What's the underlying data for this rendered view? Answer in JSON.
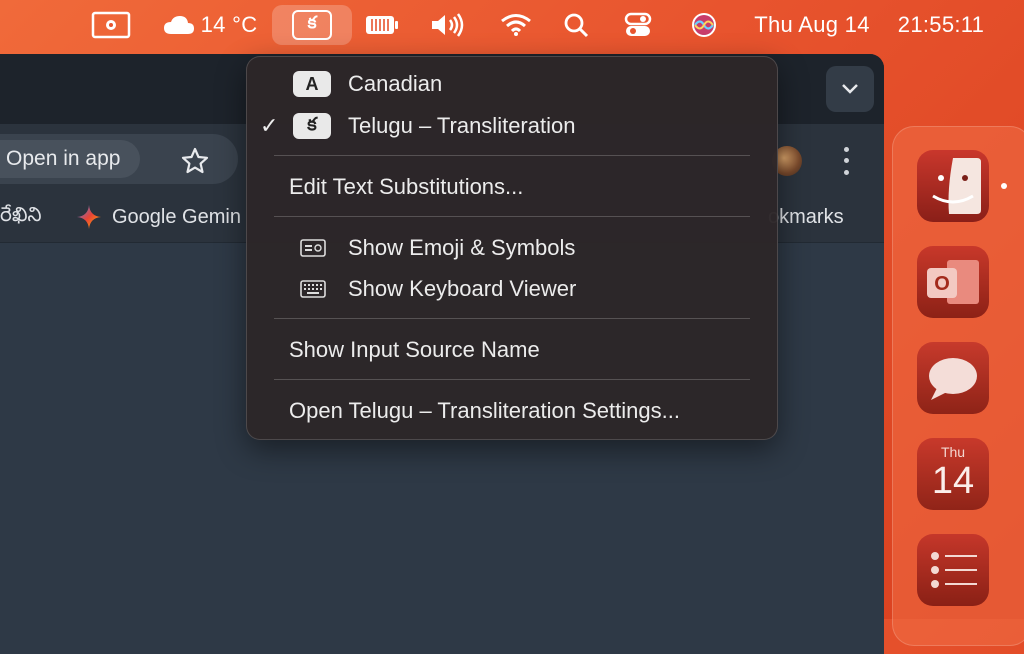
{
  "menubar": {
    "weather_temp": "14 °C",
    "input_source_glyph": "క",
    "date": "Thu Aug 14",
    "time": "21:55:11",
    "icons": [
      "screen-record-icon",
      "cloud-icon",
      "input-source-icon",
      "battery-icon",
      "volume-icon",
      "wifi-icon",
      "search-icon",
      "control-center-icon",
      "siri-icon"
    ]
  },
  "browser": {
    "open_in_app": "Open in app",
    "bookmarks": [
      "రేఖిని",
      "Google Gemin",
      "okmarks"
    ]
  },
  "menu": {
    "input_sources": [
      {
        "badge": "A",
        "label": "Canadian",
        "checked": false
      },
      {
        "badge": "క",
        "label": "Telugu – Transliteration",
        "checked": true
      }
    ],
    "check_mark": "✓",
    "edit_substitutions": "Edit Text Substitutions...",
    "show_emoji": "Show Emoji & Symbols",
    "show_keyboard_viewer": "Show Keyboard Viewer",
    "show_input_source_name": "Show Input Source Name",
    "open_settings": "Open Telugu – Transliteration Settings..."
  },
  "dock": {
    "calendar_month": "Thu",
    "calendar_day": "14",
    "apps": [
      "finder-icon",
      "outlook-icon",
      "messages-icon",
      "calendar-icon",
      "reminders-icon"
    ]
  },
  "colors": {
    "accent": "#e8542e",
    "menu_bg": "#2c2628",
    "browser_bg": "#2e3946"
  }
}
